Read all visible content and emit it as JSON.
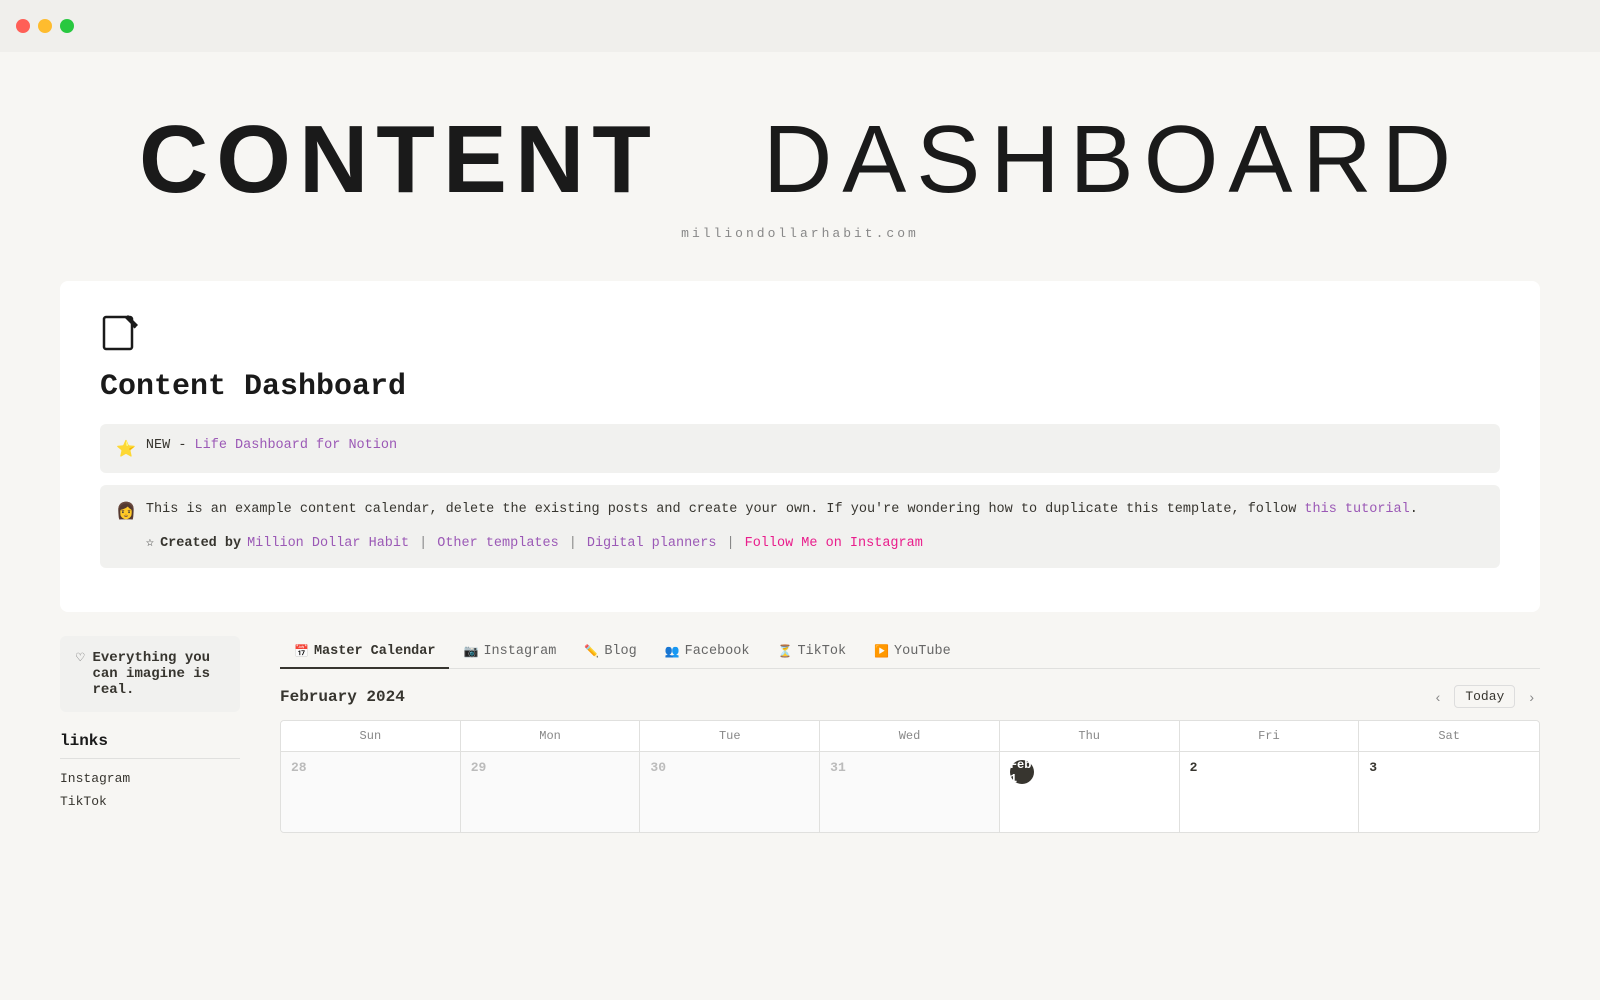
{
  "titlebar": {
    "traffic_lights": [
      "red",
      "yellow",
      "green"
    ]
  },
  "hero": {
    "title_bold": "CONTENT",
    "title_light": "DASHBOARD",
    "subtitle": "milliondollarhabit.com"
  },
  "page": {
    "icon": "✏️",
    "title": "Content Dashboard"
  },
  "callout_new": {
    "icon": "⭐",
    "text": "NEW - ",
    "link_text": "Life Dashboard for Notion",
    "link_href": "#"
  },
  "callout_info": {
    "icon": "👩",
    "main_text": "This is an example content calendar, delete the existing posts and create your own. If you're wondering how to duplicate this template, follow ",
    "tutorial_link_text": "this tutorial",
    "tutorial_link_href": "#",
    "period": ".",
    "links": {
      "label": "Created by",
      "items": [
        {
          "text": "Million Dollar Habit",
          "href": "#",
          "color": "purple"
        },
        {
          "separator": "|"
        },
        {
          "text": "Other templates",
          "href": "#",
          "color": "purple"
        },
        {
          "separator": "|"
        },
        {
          "text": "Digital planners",
          "href": "#",
          "color": "purple"
        },
        {
          "separator": "|"
        },
        {
          "text": "Follow Me on Instagram",
          "href": "#",
          "color": "pink"
        }
      ]
    }
  },
  "sidebar": {
    "quote": "Everything you can imagine is real.",
    "links_title": "links",
    "links": [
      {
        "label": "Instagram"
      },
      {
        "label": "TikTok"
      }
    ]
  },
  "calendar": {
    "month": "February 2024",
    "today_label": "Today",
    "tabs": [
      {
        "id": "master",
        "icon": "📅",
        "label": "Master Calendar",
        "active": true
      },
      {
        "id": "instagram",
        "icon": "📷",
        "label": "Instagram",
        "active": false
      },
      {
        "id": "blog",
        "icon": "✏️",
        "label": "Blog",
        "active": false
      },
      {
        "id": "facebook",
        "icon": "👥",
        "label": "Facebook",
        "active": false
      },
      {
        "id": "tiktok",
        "icon": "⏳",
        "label": "TikTok",
        "active": false
      },
      {
        "id": "youtube",
        "icon": "▶️",
        "label": "YouTube",
        "active": false
      }
    ],
    "weekdays": [
      "Sun",
      "Mon",
      "Tue",
      "Wed",
      "Thu",
      "Fri",
      "Sat"
    ],
    "rows": [
      {
        "cells": [
          {
            "day": "28",
            "other_month": true
          },
          {
            "day": "29",
            "other_month": true
          },
          {
            "day": "30",
            "other_month": true
          },
          {
            "day": "31",
            "other_month": true
          },
          {
            "day": "Feb 1",
            "today": true
          },
          {
            "day": "2",
            "other_month": false
          },
          {
            "day": "3",
            "other_month": false
          }
        ]
      }
    ]
  }
}
